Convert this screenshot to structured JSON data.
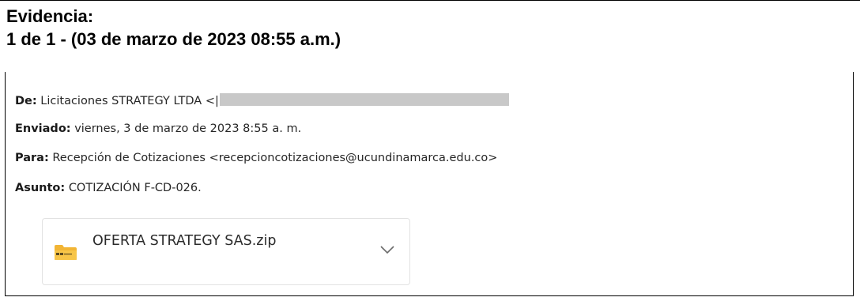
{
  "heading": {
    "line1": "Evidencia:",
    "line2": "1 de 1 - (03 de marzo de 2023 08:55 a.m.)"
  },
  "email": {
    "from": {
      "label": "De:",
      "value": "Licitaciones STRATEGY LTDA <|"
    },
    "sent": {
      "label": "Enviado:",
      "value": "viernes, 3 de marzo de 2023 8:55 a. m."
    },
    "to": {
      "label": "Para:",
      "value": "Recepción de Cotizaciones <recepcioncotizaciones@ucundinamarca.edu.co>"
    },
    "subject": {
      "label": "Asunto:",
      "value": "COTIZACIÓN F-CD-026."
    }
  },
  "attachment": {
    "filename": "OFERTA STRATEGY SAS.zip",
    "icon": "zip-folder-icon",
    "menu_icon": "chevron-down-icon"
  },
  "colors": {
    "text": "#262626",
    "redaction": "#c8c8c8",
    "zip_folder": "#f2b535"
  }
}
